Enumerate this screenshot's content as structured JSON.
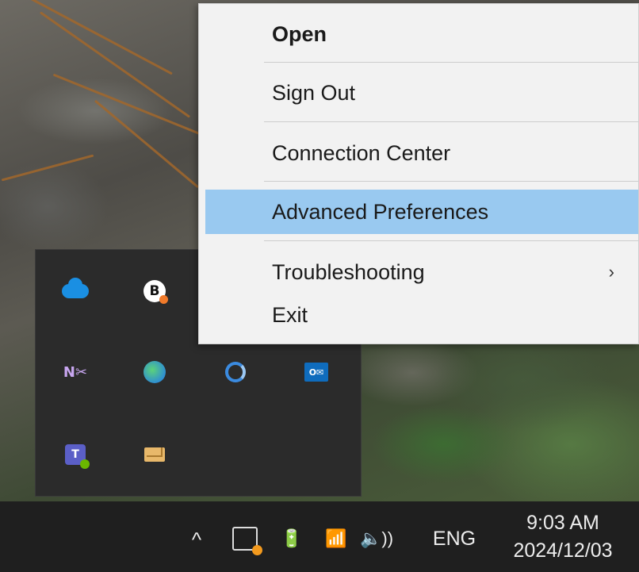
{
  "context_menu": {
    "items": [
      {
        "label": "Open",
        "bold": true
      },
      {
        "label": "Sign Out"
      },
      {
        "label": "Connection Center"
      },
      {
        "label": "Advanced Preferences",
        "highlighted": true
      },
      {
        "label": "Troubleshooting",
        "submenu": true
      },
      {
        "label": "Exit"
      }
    ],
    "highlight_color": "#99c9f0"
  },
  "tray_flyout": {
    "icons": [
      {
        "name": "onedrive-icon"
      },
      {
        "name": "b-app-icon",
        "glyph": "B"
      },
      {
        "name": "onenote-clipper-icon",
        "glyph": "N✂"
      },
      {
        "name": "globe-app-icon"
      },
      {
        "name": "swirl-app-icon"
      },
      {
        "name": "outlook-icon",
        "glyph": "O✉"
      },
      {
        "name": "teams-icon",
        "glyph": "T"
      },
      {
        "name": "mail-icon"
      }
    ]
  },
  "taskbar": {
    "caret_glyph": "^",
    "battery_glyph": "🔋",
    "wifi_glyph": "📶",
    "volume_glyph": "🔈))",
    "language": "ENG",
    "time": "9:03 AM",
    "date": "2024/12/03",
    "notification_dot_color": "#f39a1e"
  }
}
